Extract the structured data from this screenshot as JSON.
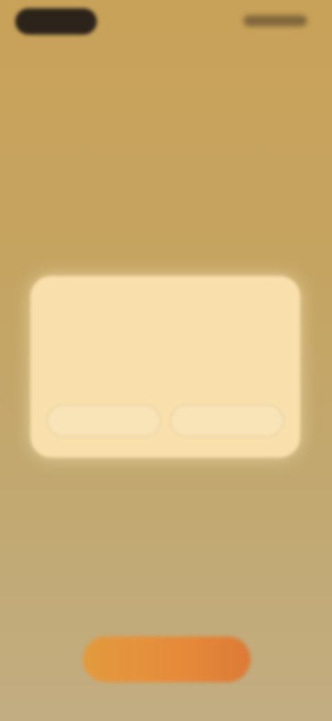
{
  "status_bar": {
    "time": "",
    "indicators": ""
  },
  "dialog": {
    "title": "",
    "message": "",
    "secondary_button": "",
    "primary_button": ""
  },
  "bottom_button": {
    "label": ""
  },
  "colors": {
    "background_top": "#c9a259",
    "background_bottom": "#c2ad82",
    "dialog_bg": "#f8dfac",
    "accent": "#e58a3a"
  }
}
